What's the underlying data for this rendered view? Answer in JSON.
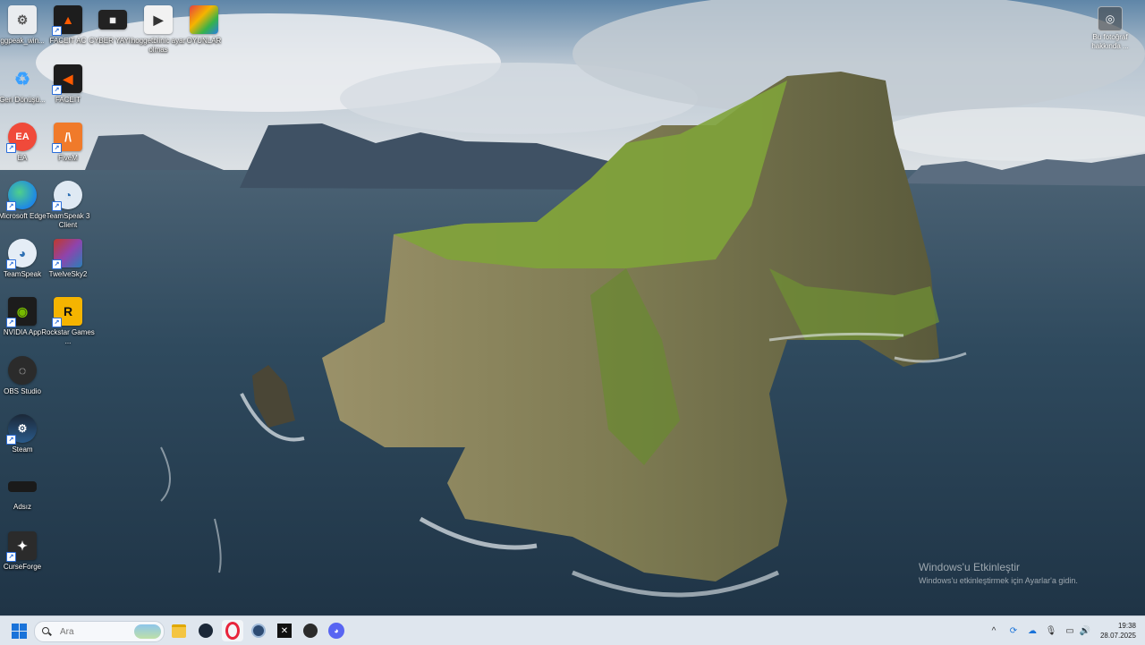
{
  "desktop": {
    "icons": [
      {
        "label": "ggpeak_win..."
      },
      {
        "label": "FACEIT AC"
      },
      {
        "label": "CYBER YAYI..."
      },
      {
        "label": "hoggetblinic ayar olmas"
      },
      {
        "label": "OYUNLAR"
      },
      {
        "label": "Geri Dönüşü..."
      },
      {
        "label": "FACEIT"
      },
      {
        "label": "EA"
      },
      {
        "label": "FiveM"
      },
      {
        "label": "Microsoft Edge"
      },
      {
        "label": "TeamSpeak 3 Client"
      },
      {
        "label": "TeamSpeak"
      },
      {
        "label": "TwelveSky2"
      },
      {
        "label": "NVIDIA App"
      },
      {
        "label": "Rockstar Games ..."
      },
      {
        "label": "OBS Studio"
      },
      {
        "label": "Steam"
      },
      {
        "label": "Adsız"
      },
      {
        "label": "CurseForge"
      }
    ],
    "photo_info": {
      "label": "Bu fotoğraf hakkında ..."
    }
  },
  "activation": {
    "title": "Windows'u Etkinleştir",
    "subtitle": "Windows'u etkinleştirmek için Ayarlar'a gidin."
  },
  "taskbar": {
    "search_placeholder": "Ara",
    "pinned": [
      "start-icon",
      "file-explorer-icon",
      "steam-icon",
      "opera-icon",
      "teamspeak-icon",
      "capcut-icon",
      "obs-icon",
      "discord-icon"
    ],
    "time": "19:38",
    "date": "28.07.2025"
  },
  "colors": {
    "taskbar_bg": "#dfe6ee",
    "accent": "#1a73d9"
  }
}
